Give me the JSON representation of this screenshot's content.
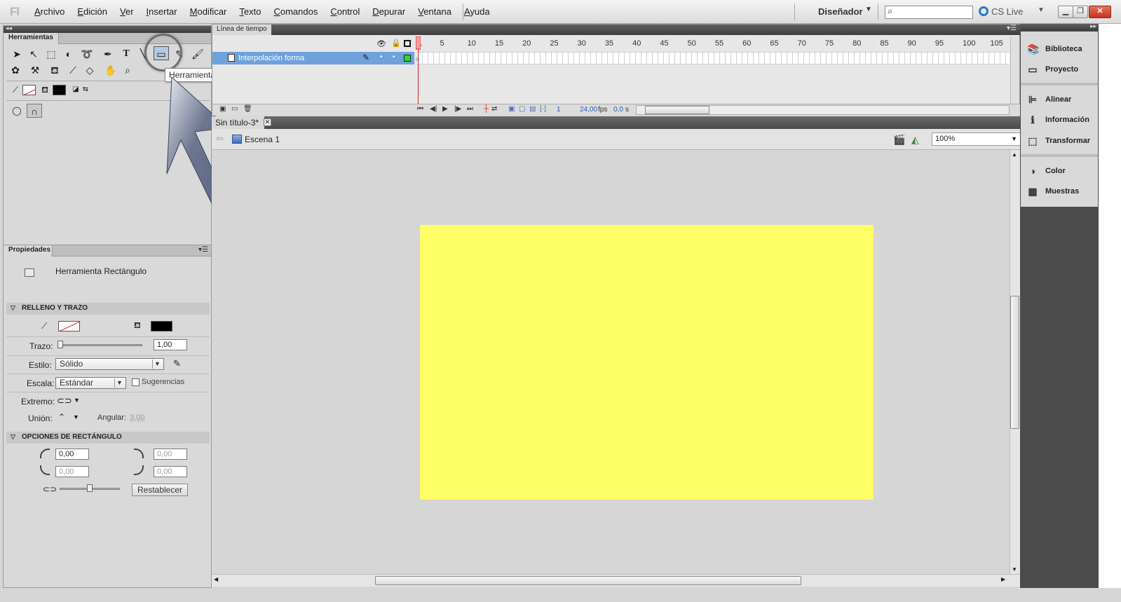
{
  "app": {
    "logo": "Fl"
  },
  "menu": {
    "items": [
      {
        "pre": "",
        "u": "A",
        "post": "rchivo"
      },
      {
        "pre": "",
        "u": "E",
        "post": "dición"
      },
      {
        "pre": "",
        "u": "V",
        "post": "er"
      },
      {
        "pre": "",
        "u": "I",
        "post": "nsertar"
      },
      {
        "pre": "",
        "u": "M",
        "post": "odificar"
      },
      {
        "pre": "",
        "u": "T",
        "post": "exto"
      },
      {
        "pre": "",
        "u": "C",
        "post": "omandos"
      },
      {
        "pre": "",
        "u": "C",
        "post": "ontrol"
      },
      {
        "pre": "",
        "u": "D",
        "post": "epurar"
      },
      {
        "pre": "",
        "u": "V",
        "post": "entana"
      },
      {
        "pre": "",
        "u": "A",
        "post": "yuda"
      }
    ],
    "workspace": "Diseñador",
    "search_placeholder": "",
    "cslive": "CS Live"
  },
  "tools": {
    "tab": "Herramientas",
    "tooltip": "Herramienta Rectángulo (R)"
  },
  "properties": {
    "tab": "Propiedades",
    "tool_name": "Herramienta Rectángulo",
    "fill_stroke_header": "RELLENO Y TRAZO",
    "trazo_label": "Trazo:",
    "trazo_value": "1,00",
    "estilo_label": "Estilo:",
    "estilo_value": "Sólido",
    "escala_label": "Escala:",
    "escala_value": "Estándar",
    "sugerencias_label": "Sugerencias",
    "extremo_label": "Extremo:",
    "union_label": "Unión:",
    "angular_label": "Angular:",
    "angular_value": "3,00",
    "rect_options_header": "OPCIONES DE RECTÁNGULO",
    "corner_tl": "0,00",
    "corner_tr": "0,00",
    "corner_bl": "0,00",
    "corner_br": "0,00",
    "reset_button": "Restablecer",
    "stroke_color": "#ff0000",
    "fill_color": "#000000"
  },
  "timeline": {
    "tab": "Línea de tiempo",
    "layer_name": "Interpolación forma",
    "frame_numbers": [
      "1",
      "5",
      "10",
      "15",
      "20",
      "25",
      "30",
      "35",
      "40",
      "45",
      "50",
      "55",
      "60",
      "65",
      "70",
      "75",
      "80",
      "85",
      "90",
      "95",
      "100",
      "105"
    ],
    "current_frame": "1",
    "fps": "24,00",
    "fps_unit": "fps",
    "time": "0,0",
    "time_unit": "s"
  },
  "document": {
    "tab": "Sin título-3*",
    "scene": "Escena 1",
    "zoom": "100%",
    "stage_color": "#ffff66"
  },
  "dock": {
    "items": [
      "Biblioteca",
      "Proyecto",
      "Alinear",
      "Información",
      "Transformar",
      "Color",
      "Muestras"
    ]
  }
}
